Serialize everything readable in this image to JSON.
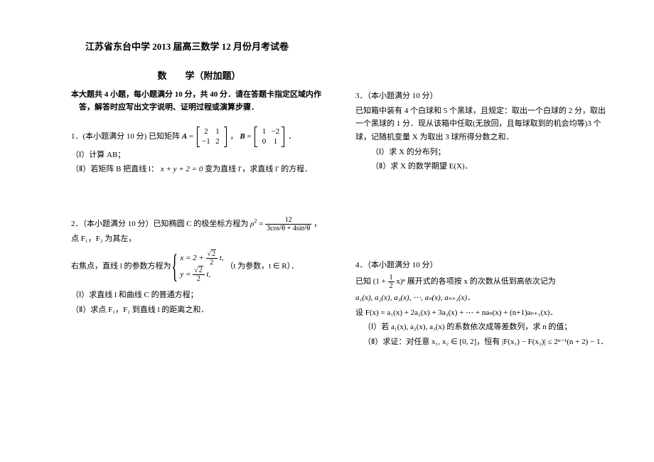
{
  "title": "江苏省东台中学 2013 届高三数学 12 月份月考试卷",
  "subtitle": "数　　学（附加题）",
  "instructions": "本大题共 4 小题，每小题满分 10 分，共 40 分．请在答题卡指定区域内作答，解答时应写出文字说明、证明过程或演算步骤．",
  "p1": {
    "head": "1．(本小题满分 10 分) 已知矩阵 ",
    "matA_label": "A",
    "eq1": " = ",
    "a11": "2",
    "a12": "1",
    "a21": "−1",
    "a22": "2",
    "comma": "，",
    "matB_label": "B",
    "eq2": " = ",
    "b11": "1",
    "b12": "−2",
    "b21": "0",
    "b22": "1",
    "period": "．",
    "part1": "（Ⅰ）计算 AB；",
    "part2_a": "（Ⅱ）若矩阵 B 把直线 l：",
    "part2_eq": "x + y + 2 = 0",
    "part2_b": " 变为直线 l′，求直线 l′ 的方程．"
  },
  "p2": {
    "head": "2．（本小题满分 10 分）已知椭圆 C 的极坐标方程为 ",
    "rho": "ρ",
    "eq": " = ",
    "num": "12",
    "den": "3cos²θ + 4sin²θ",
    "tail": "，点 F₁，F₂ 为其左，",
    "line2a": "右焦点，直线 l 的参数方程为 ",
    "sys1": "x = 2 + ",
    "sys1b": " t,",
    "sys2": "y = ",
    "sys2b": " t,",
    "sqrt2": "2",
    "denom2": "2",
    "sys_tail": "（t 为参数，t ∈ R）．",
    "part1": "（Ⅰ）求直线 l 和曲线 C 的普通方程；",
    "part2": "（Ⅱ）求点 F₁，F₂ 到直线 l 的距离之和．"
  },
  "p3": {
    "head": "3．（本小题满分 10 分）",
    "line1": "已知箱中装有 4 个白球和 5 个黑球，且规定：取出一个白球的 2 分，取出一个黑球的 1 分．现从该箱中任取(无放回，且每球取到的机会均等)3 个球，记随机变量 X 为取出 3 球所得分数之和．",
    "part1": "（Ⅰ）求 X 的分布列；",
    "part2": "（Ⅱ）求 X 的数学期望 E(X)．"
  },
  "p4": {
    "head": "4．（本小题满分 10 分）",
    "line1a": "已知 (1 + ",
    "frac_num": "1",
    "frac_den": "2",
    "line1b": " x)ⁿ 展开式的各项按 x 的次数从低到高依次记为",
    "line2": "a₁(x), a₂(x), a₃(x), ⋯, aₙ(x), aₙ₊₁(x)．",
    "line3": "设 F(x) = a₁(x) + 2a₂(x) + 3a₃(x) + ⋯ + naₙ(x) + (n+1)aₙ₊₁(x)．",
    "part1": "（Ⅰ）若 a₁(x), a₂(x), a₃(x) 的系数依次成等差数列，求 n 的值；",
    "part2": "（Ⅱ）求证：对任意 x₁, x₂ ∈ [0, 2]，恒有 |F(x₁) − F(x₂)| ≤ 2ⁿ⁻¹(n + 2) − 1．"
  }
}
